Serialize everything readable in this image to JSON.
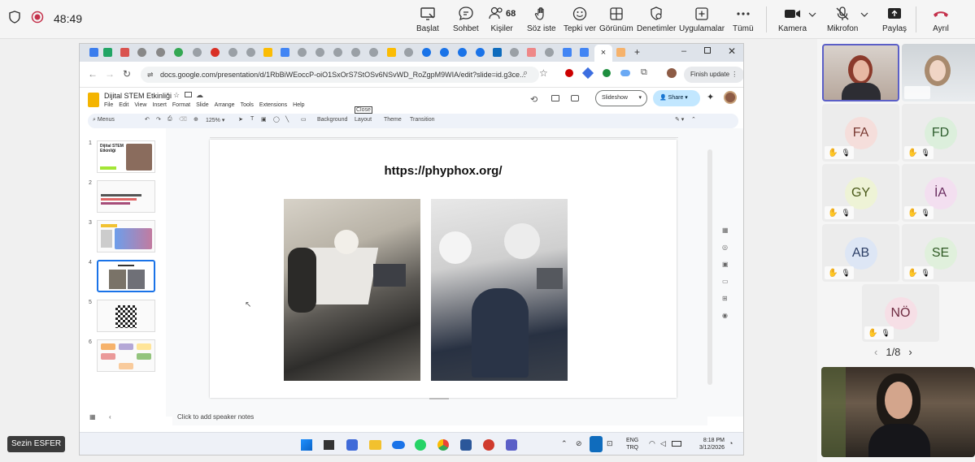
{
  "meeting": {
    "timer": "48:49",
    "participants_count": "68",
    "toolbar": {
      "start": "Başlat",
      "chat": "Sohbet",
      "people": "Kişiler",
      "raise_hand": "Söz iste",
      "react": "Tepki ver",
      "view": "Görünüm",
      "controls": "Denetimler",
      "apps": "Uygulamalar",
      "more": "Tümü",
      "camera": "Kamera",
      "mic": "Mikrofon",
      "share": "Paylaş",
      "leave": "Ayrıl"
    },
    "leave_color": "#c4314b",
    "presenter_name": "Sezin ESFER",
    "gallery": {
      "tiles": [
        {
          "initials": "FA"
        },
        {
          "initials": "FD"
        },
        {
          "initials": "GY"
        },
        {
          "initials": "İA"
        },
        {
          "initials": "AB"
        },
        {
          "initials": "SE"
        },
        {
          "initials": "NÖ"
        }
      ],
      "pager": "1/8"
    }
  },
  "browser": {
    "url": "docs.google.com/presentation/d/1RbBiWEoccP-oiO1SxOrS7StOSv6NSvWD_RoZgpM9WIA/edit?slide=id.g3ce...",
    "finish_update": "Finish update"
  },
  "slides": {
    "doc_title": "Dijital STEM Etkinliği",
    "menu": [
      "File",
      "Edit",
      "View",
      "Insert",
      "Format",
      "Slide",
      "Arrange",
      "Tools",
      "Extensions",
      "Help"
    ],
    "slideshow": "Slideshow",
    "share": "Share",
    "toolbar": {
      "menus": "Menus",
      "zoom": "125%",
      "background": "Background",
      "layout": "Layout",
      "theme": "Theme",
      "transition": "Transition",
      "close_tooltip": "Close"
    },
    "thumb_numbers": [
      "1",
      "2",
      "3",
      "4",
      "5",
      "6"
    ],
    "thumb1_title": "Dijital STEM Etkinliği",
    "current_slide_title": "https://phyphox.org/",
    "speaker_notes": "Click to add speaker notes"
  },
  "windows_taskbar": {
    "lang": "ENG",
    "locale": "TRQ",
    "time": "8:18 PM",
    "date": "3/12/2026"
  }
}
